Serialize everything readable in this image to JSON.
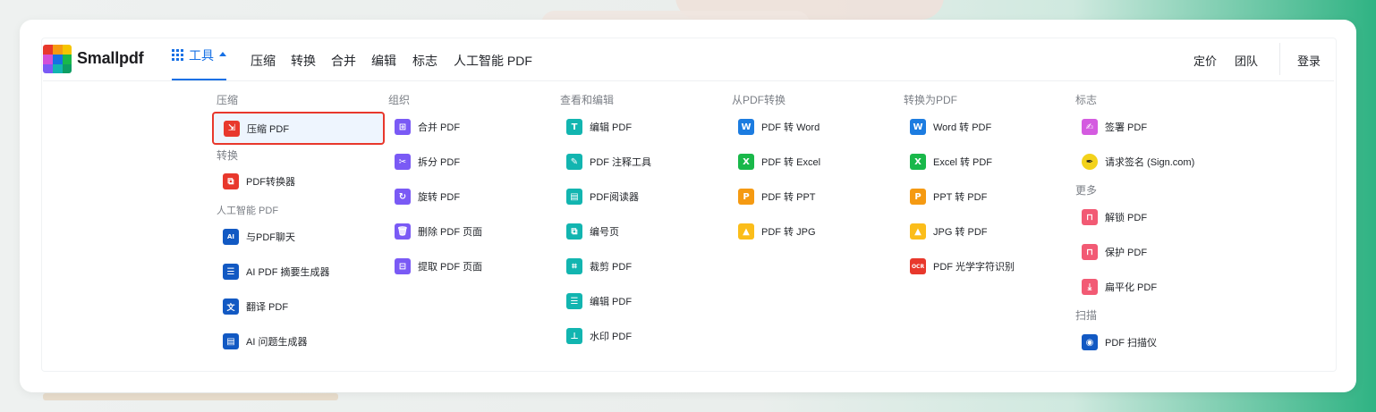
{
  "brand": {
    "name": "Smallpdf"
  },
  "header": {
    "tools_tab": "工具",
    "nav": [
      "压缩",
      "转换",
      "合并",
      "编辑",
      "标志",
      "人工智能 PDF"
    ],
    "pricing": "定价",
    "team": "团队",
    "login": "登录"
  },
  "colors": {
    "accent": "#1670e5",
    "compress": "#e8382c",
    "organize": "#7a5af5",
    "edit": "#12b5b0",
    "word": "#1c7ce0",
    "excel": "#19b84a",
    "ppt": "#f59a12",
    "jpg": "#fbbd1a",
    "sign": "#d45be0",
    "ai": "#1259c3"
  },
  "menu": {
    "compress": {
      "title": "压缩",
      "items": [
        {
          "label": "压缩 PDF",
          "icon": "compress-icon"
        }
      ]
    },
    "convert": {
      "title": "转换",
      "items": [
        {
          "label": "PDF转换器",
          "icon": "converter-icon"
        }
      ]
    },
    "ai": {
      "title": "人工智能 PDF",
      "items": [
        {
          "label": "与PDF聊天",
          "icon": "chat-ai-icon"
        },
        {
          "label": "AI PDF 摘要生成器",
          "icon": "list-icon"
        },
        {
          "label": "翻译 PDF",
          "icon": "translate-icon"
        },
        {
          "label": "AI 问题生成器",
          "icon": "question-doc-icon"
        }
      ]
    },
    "organize": {
      "title": "组织",
      "items": [
        {
          "label": "合并 PDF",
          "icon": "merge-icon"
        },
        {
          "label": "拆分 PDF",
          "icon": "scissors-icon"
        },
        {
          "label": "旋转 PDF",
          "icon": "rotate-icon"
        },
        {
          "label": "删除 PDF 页面",
          "icon": "trash-icon"
        },
        {
          "label": "提取 PDF 页面",
          "icon": "extract-icon"
        }
      ]
    },
    "view_edit": {
      "title": "查看和编辑",
      "items": [
        {
          "label": "编辑 PDF",
          "icon": "text-edit-icon"
        },
        {
          "label": "PDF 注释工具",
          "icon": "pen-icon"
        },
        {
          "label": "PDF阅读器",
          "icon": "reader-icon"
        },
        {
          "label": "编号页",
          "icon": "page-number-icon"
        },
        {
          "label": "裁剪 PDF",
          "icon": "crop-icon"
        },
        {
          "label": "编辑 PDF",
          "icon": "form-icon"
        },
        {
          "label": "水印 PDF",
          "icon": "stamp-icon"
        }
      ]
    },
    "from_pdf": {
      "title": "从PDF转换",
      "items": [
        {
          "label": "PDF 转 Word",
          "icon": "word-icon"
        },
        {
          "label": "PDF 转 Excel",
          "icon": "excel-icon"
        },
        {
          "label": "PDF 转 PPT",
          "icon": "ppt-icon"
        },
        {
          "label": "PDF 转 JPG",
          "icon": "jpg-icon"
        }
      ]
    },
    "to_pdf": {
      "title": "转换为PDF",
      "items": [
        {
          "label": "Word 转 PDF",
          "icon": "word-icon"
        },
        {
          "label": "Excel 转 PDF",
          "icon": "excel-icon"
        },
        {
          "label": "PPT 转 PDF",
          "icon": "ppt-icon"
        },
        {
          "label": "JPG 转 PDF",
          "icon": "jpg-icon"
        },
        {
          "label": "PDF 光学字符识别",
          "icon": "ocr-icon"
        }
      ]
    },
    "sign": {
      "title": "标志",
      "items": [
        {
          "label": "签署 PDF",
          "icon": "signature-icon"
        },
        {
          "label": "请求签名 (Sign.com)",
          "icon": "pen-nib-icon"
        }
      ]
    },
    "more": {
      "title": "更多",
      "items": [
        {
          "label": "解锁 PDF",
          "icon": "unlock-icon"
        },
        {
          "label": "保护 PDF",
          "icon": "lock-icon"
        },
        {
          "label": "扁平化 PDF",
          "icon": "flatten-icon"
        }
      ]
    },
    "scan": {
      "title": "扫描",
      "items": [
        {
          "label": "PDF 扫描仪",
          "icon": "camera-icon"
        }
      ]
    }
  }
}
